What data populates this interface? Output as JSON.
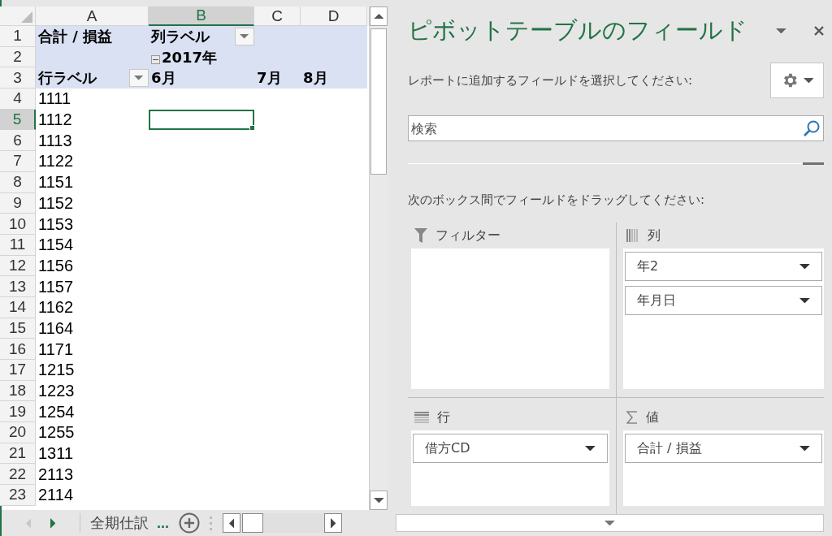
{
  "spreadsheet": {
    "columns": [
      {
        "label": "A",
        "selected": false
      },
      {
        "label": "B",
        "selected": true
      },
      {
        "label": "C",
        "selected": false
      },
      {
        "label": "D",
        "selected": false
      }
    ],
    "rows": [
      {
        "number": "1",
        "kind": "header",
        "selected": false,
        "cells": [
          {
            "text": "合計 / 損益"
          },
          {
            "text": "列ラベル",
            "filter_button": true
          },
          null,
          null
        ]
      },
      {
        "number": "2",
        "kind": "header",
        "selected": false,
        "cells": [
          null,
          {
            "text": "2017年",
            "collapse_button": true
          },
          null,
          null
        ]
      },
      {
        "number": "3",
        "kind": "header",
        "selected": false,
        "cells": [
          {
            "text": "行ラベル",
            "filter_button": true
          },
          {
            "text": "6月"
          },
          {
            "text": "7月"
          },
          {
            "text": "8月"
          }
        ]
      },
      {
        "number": "4",
        "kind": "data",
        "selected": false,
        "cells": [
          {
            "text": "1111"
          }
        ]
      },
      {
        "number": "5",
        "kind": "data",
        "selected": true,
        "cells": [
          {
            "text": "1112"
          }
        ]
      },
      {
        "number": "6",
        "kind": "data",
        "selected": false,
        "cells": [
          {
            "text": "1113"
          }
        ]
      },
      {
        "number": "7",
        "kind": "data",
        "selected": false,
        "cells": [
          {
            "text": "1122"
          }
        ]
      },
      {
        "number": "8",
        "kind": "data",
        "selected": false,
        "cells": [
          {
            "text": "1151"
          }
        ]
      },
      {
        "number": "9",
        "kind": "data",
        "selected": false,
        "cells": [
          {
            "text": "1152"
          }
        ]
      },
      {
        "number": "10",
        "kind": "data",
        "selected": false,
        "cells": [
          {
            "text": "1153"
          }
        ]
      },
      {
        "number": "11",
        "kind": "data",
        "selected": false,
        "cells": [
          {
            "text": "1154"
          }
        ]
      },
      {
        "number": "12",
        "kind": "data",
        "selected": false,
        "cells": [
          {
            "text": "1156"
          }
        ]
      },
      {
        "number": "13",
        "kind": "data",
        "selected": false,
        "cells": [
          {
            "text": "1157"
          }
        ]
      },
      {
        "number": "14",
        "kind": "data",
        "selected": false,
        "cells": [
          {
            "text": "1162"
          }
        ]
      },
      {
        "number": "15",
        "kind": "data",
        "selected": false,
        "cells": [
          {
            "text": "1164"
          }
        ]
      },
      {
        "number": "16",
        "kind": "data",
        "selected": false,
        "cells": [
          {
            "text": "1171"
          }
        ]
      },
      {
        "number": "17",
        "kind": "data",
        "selected": false,
        "cells": [
          {
            "text": "1215"
          }
        ]
      },
      {
        "number": "18",
        "kind": "data",
        "selected": false,
        "cells": [
          {
            "text": "1223"
          }
        ]
      },
      {
        "number": "19",
        "kind": "data",
        "selected": false,
        "cells": [
          {
            "text": "1254"
          }
        ]
      },
      {
        "number": "20",
        "kind": "data",
        "selected": false,
        "cells": [
          {
            "text": "1255"
          }
        ]
      },
      {
        "number": "21",
        "kind": "data",
        "selected": false,
        "cells": [
          {
            "text": "1311"
          }
        ]
      },
      {
        "number": "22",
        "kind": "data",
        "selected": false,
        "cells": [
          {
            "text": "2113"
          }
        ]
      },
      {
        "number": "23",
        "kind": "data",
        "selected": false,
        "cells": [
          {
            "text": "2114"
          }
        ]
      }
    ]
  },
  "sheet_tabs": {
    "tabs": [
      {
        "label": "全期仕訳",
        "selected": false
      }
    ],
    "more": "..."
  },
  "pivot_panel": {
    "title": "ピボットテーブルのフィールド",
    "choose_label": "レポートに追加するフィールドを選択してください:",
    "search": {
      "placeholder": "検索"
    },
    "drag_label": "次のボックス間でフィールドをドラッグしてください:",
    "areas": [
      {
        "kind": "filter",
        "label": "フィルター"
      },
      {
        "kind": "columns",
        "label": "列",
        "fields": [
          "年2",
          "年月日"
        ]
      },
      {
        "kind": "rows",
        "label": "行",
        "fields": [
          "借方CD"
        ]
      },
      {
        "kind": "values",
        "label": "値",
        "fields": [
          "合計 / 損益"
        ]
      }
    ]
  }
}
